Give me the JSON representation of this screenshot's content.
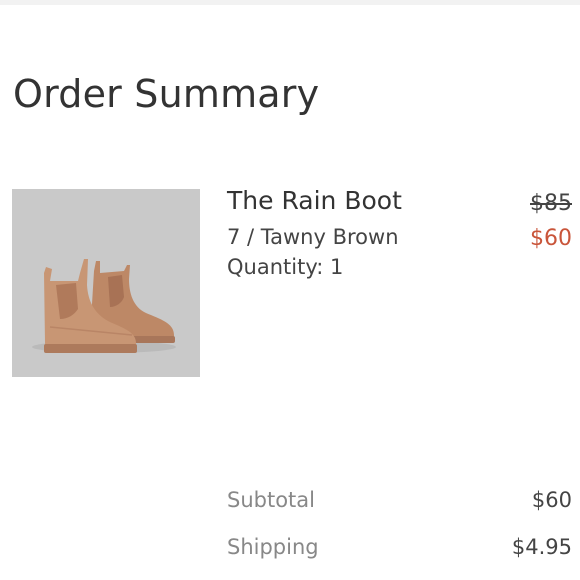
{
  "page": {
    "title": "Order Summary"
  },
  "product": {
    "name": "The Rain Boot",
    "variant": "7 / Tawny Brown",
    "quantity": "Quantity: 1",
    "original_price": "$85",
    "sale_price": "$60",
    "image_icon": "rain-boot-image",
    "colors": {
      "boot": "#c69472",
      "sale_price": "#c9553a"
    }
  },
  "summary": {
    "subtotal_label": "Subtotal",
    "subtotal_value": "$60",
    "shipping_label": "Shipping",
    "shipping_value": "$4.95"
  }
}
